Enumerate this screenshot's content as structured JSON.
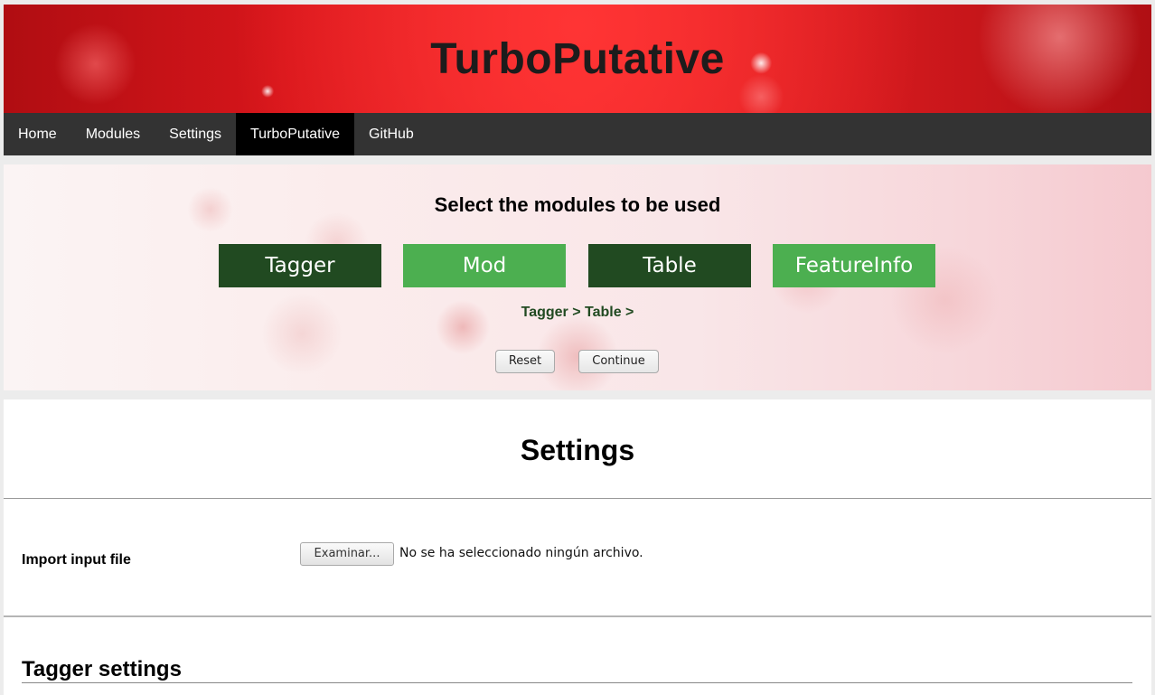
{
  "header": {
    "title": "TurboPutative"
  },
  "nav": {
    "items": [
      {
        "label": "Home",
        "active": false
      },
      {
        "label": "Modules",
        "active": false
      },
      {
        "label": "Settings",
        "active": false
      },
      {
        "label": "TurboPutative",
        "active": true
      },
      {
        "label": "GitHub",
        "active": false
      }
    ]
  },
  "modules": {
    "title": "Select the modules to be used",
    "buttons": [
      {
        "label": "Tagger",
        "selected": true
      },
      {
        "label": "Mod",
        "selected": false
      },
      {
        "label": "Table",
        "selected": true
      },
      {
        "label": "FeatureInfo",
        "selected": false
      }
    ],
    "path": "Tagger > Table >",
    "reset_label": "Reset",
    "continue_label": "Continue"
  },
  "settings": {
    "title": "Settings",
    "import_label": "Import input file",
    "file_button_label": "Examinar...",
    "file_status": "No se ha seleccionado ningún archivo.",
    "tagger_title": "Tagger settings"
  },
  "colors": {
    "selected_module": "#214a21",
    "unselected_module": "#4caf50",
    "navbar": "#333333",
    "header_red": "#e0181c"
  }
}
